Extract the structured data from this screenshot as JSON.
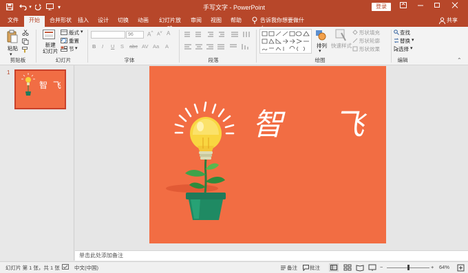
{
  "titlebar": {
    "title": "手写文字 - PowerPoint",
    "login_label": "登录"
  },
  "tabs": [
    {
      "label": "文件"
    },
    {
      "label": "开始"
    },
    {
      "label": "合并形状"
    },
    {
      "label": "插入"
    },
    {
      "label": "设计"
    },
    {
      "label": "切换"
    },
    {
      "label": "动画"
    },
    {
      "label": "幻灯片放映"
    },
    {
      "label": "审阅"
    },
    {
      "label": "视图"
    },
    {
      "label": "帮助"
    }
  ],
  "tell_me": "告诉我你想要做什么",
  "share_label": "共享",
  "ribbon": {
    "clipboard": {
      "paste_label": "粘贴",
      "group_label": "剪贴板"
    },
    "slides": {
      "new_slide_label": "新建\n幻灯片",
      "layout_label": "版式",
      "reset_label": "重置",
      "section_label": "节",
      "group_label": "幻灯片"
    },
    "font": {
      "size_value": "96",
      "group_label": "字体"
    },
    "paragraph": {
      "group_label": "段落"
    },
    "drawing": {
      "arrange_label": "排列",
      "quick_styles_label": "快速样式",
      "fill_label": "形状填充",
      "outline_label": "形状轮廓",
      "effects_label": "形状效果",
      "group_label": "绘图"
    },
    "editing": {
      "find_label": "查找",
      "replace_label": "替换",
      "select_label": "选择",
      "group_label": "编辑"
    }
  },
  "thumbnail": {
    "number": "1",
    "title": "智 飞"
  },
  "slide": {
    "title": "智 飞"
  },
  "notes_placeholder": "单击此处添加备注",
  "status": {
    "slide_info": "幻灯片 第 1 张，共 1 张",
    "language": "中文(中国)",
    "notes_label": "备注",
    "comments_label": "批注",
    "zoom": "64%"
  },
  "colors": {
    "brand": "#b7472a",
    "slide_bg": "#f26d43"
  }
}
